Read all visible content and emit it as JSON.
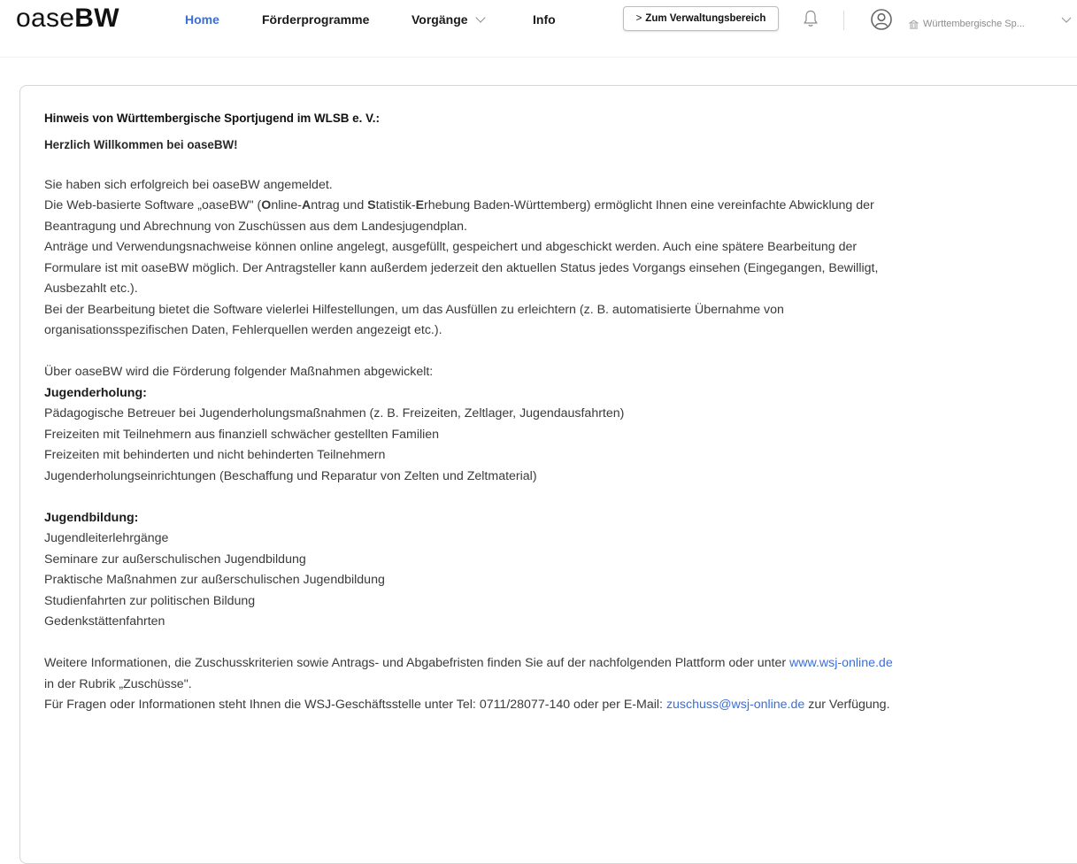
{
  "header": {
    "logo_light": "oase",
    "logo_bold": "BW",
    "nav": {
      "home": "Home",
      "foerderprogramme": "Förderprogramme",
      "vorgaenge": "Vorgänge",
      "info": "Info"
    },
    "admin_button": "Zum Verwaltungsbereich",
    "organization": "Württembergische Sp...",
    "accent_color": "#3b6fd8"
  },
  "notice": {
    "heading": "Hinweis von Württembergische Sportjugend im WLSB e. V.:",
    "welcome": "Herzlich Willkommen bei oaseBW!",
    "p1": "Sie haben sich erfolgreich bei oaseBW angemeldet.",
    "p2_pre": "Die Web-basierte Software „oaseBW\" (",
    "p2_o": "O",
    "p2_nline": "nline-",
    "p2_a": "A",
    "p2_ntrag": "ntrag und ",
    "p2_s": "S",
    "p2_tatistik": "tatistik-",
    "p2_e": "E",
    "p2_post": "rhebung Baden-Württemberg) ermöglicht Ihnen eine vereinfachte Abwicklung der",
    "p2_line2": "Beantragung und Abrechnung von Zuschüssen aus dem Landesjugendplan.",
    "p3_l1": "Anträge und Verwendungsnachweise können online angelegt, ausgefüllt, gespeichert und abgeschickt werden. Auch eine spätere Bearbeitung der",
    "p3_l2": "Formulare ist mit oaseBW möglich. Der Antragsteller kann außerdem jederzeit den aktuellen Status jedes Vorgangs einsehen (Eingegangen, Bewilligt,",
    "p3_l3": "Ausbezahlt etc.).",
    "p4_l1": "Bei der Bearbeitung bietet die Software vielerlei Hilfestellungen, um das Ausfüllen zu erleichtern (z. B. automatisierte Übernahme von",
    "p4_l2": "organisationsspezifischen Daten, Fehlerquellen werden angezeigt etc.).",
    "p5": "Über oaseBW wird die Förderung folgender Maßnahmen abgewickelt:",
    "section1_title": "Jugenderholung:",
    "section1_items": [
      "Pädagogische Betreuer bei Jugenderholungsmaßnahmen (z. B. Freizeiten, Zeltlager, Jugendausfahrten)",
      "Freizeiten mit Teilnehmern aus finanziell schwächer gestellten Familien",
      "Freizeiten mit behinderten und nicht behinderten Teilnehmern",
      "Jugenderholungseinrichtungen (Beschaffung und Reparatur von Zelten und Zeltmaterial)"
    ],
    "section2_title": "Jugendbildung:",
    "section2_items": [
      "Jugendleiterlehrgänge",
      "Seminare zur außerschulischen Jugendbildung",
      "Praktische Maßnahmen zur außerschulischen Jugendbildung",
      "Studienfahrten zur politischen Bildung",
      "Gedenkstättenfahrten"
    ],
    "info_pre": "Weitere Informationen, die Zuschusskriterien sowie Antrags- und Abgabefristen finden Sie auf der nachfolgenden Plattform oder unter ",
    "info_link": "www.wsj-online.de",
    "info_line2": "in der Rubrik „Zuschüsse\".",
    "contact_pre": "Für Fragen oder Informationen steht Ihnen die WSJ-Geschäftsstelle unter Tel: 0711/28077-140 oder per E-Mail: ",
    "contact_email": "zuschuss@wsj-online.de",
    "contact_post": " zur Verfügung."
  }
}
